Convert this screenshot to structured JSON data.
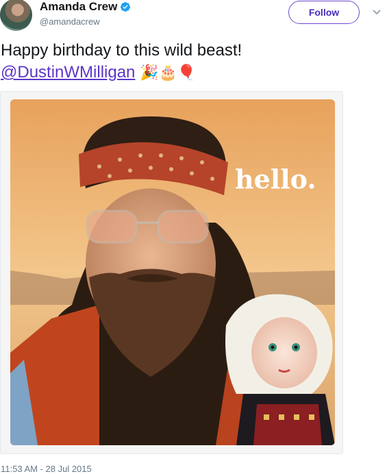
{
  "tweet": {
    "author": {
      "display_name": "Amanda Crew",
      "handle": "@amandacrew",
      "verified": true
    },
    "follow_label": "Follow",
    "menu_icon": "chevron-down-icon",
    "text": "Happy birthday to this wild beast!",
    "mention": "@DustinWMilligan",
    "emojis": [
      "🎉",
      "🎂",
      "🎈"
    ],
    "media": {
      "overlay_text": "hello."
    },
    "timestamp": "11:53 AM - 28 Jul 2015"
  },
  "colors": {
    "accent": "#5b35c9",
    "verified": "#1da1f2",
    "secondary_text": "#657786"
  }
}
